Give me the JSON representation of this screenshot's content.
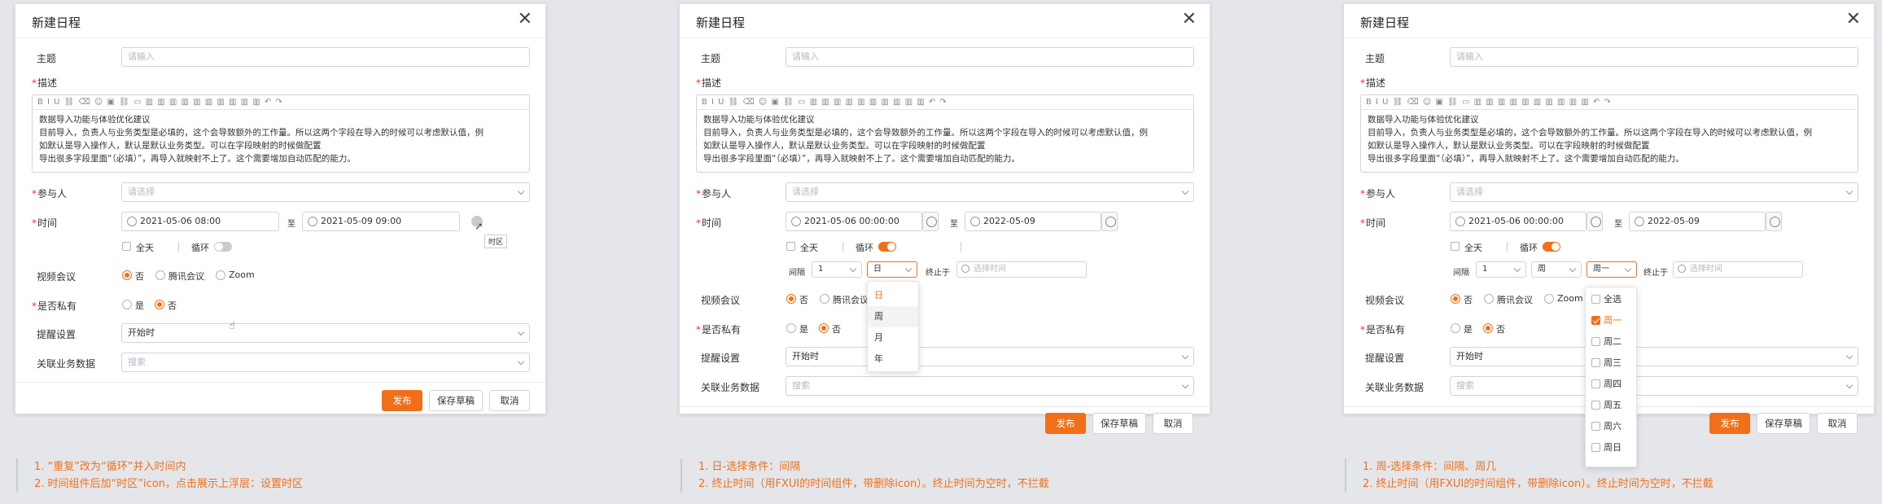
{
  "common": {
    "title": "新建日程",
    "subject_label": "主题",
    "subject_placeholder": "请输入",
    "desc_label": "描述",
    "toolbar_icons": "B  I  U  ⛓  ⌫  ☺  ▣  ⛓  ▭   ▥ ▥ ▥ ▥ ▥ ▥ ▥ ▥ ▥ ▥   ↶  ↷",
    "desc_lines": [
      "目前导入，负责人与业务类型是必填的，这个会导致额外的工作量。所以这两个字段在导入的时候可以考虑默认值，例",
      "如默认是导入操作人，默认是默认业务类型。可以在字段映射的时候做配置",
      "导出很多字段里面“（必填）”，再导入就映射不上了。这个需要增加自动匹配的能力。"
    ],
    "participant_label": "参与人",
    "participant_placeholder": "请选择",
    "time_label": "时间",
    "to": "至",
    "allday": "全天",
    "repeat": "循环",
    "video_label": "视频会议",
    "video_opts": [
      "否",
      "腾讯会议",
      "Zoom"
    ],
    "private_label": "是否私有",
    "private_opts": [
      "是",
      "否"
    ],
    "remind_label": "提醒设置",
    "remind_value": "开始时",
    "related_label": "关联业务数据",
    "related_placeholder": "搜索",
    "buttons": {
      "publish": "发布",
      "draft": "保存草稿",
      "cancel": "取消"
    },
    "interval_label": "间隔",
    "end_label": "终止于",
    "end_placeholder": "选择时间"
  },
  "panels": [
    {
      "desc_first": "数据导入功能与体验优化建议",
      "start": "2021-05-06 08:00",
      "end": "2021-05-09 09:00",
      "tooltip": "时区"
    },
    {
      "desc_first": "数据导入功能与体验优化建议",
      "start": "2021-05-06 00:00:00",
      "end": "2022-05-09",
      "interval": "1",
      "unit": "日",
      "unit_options": [
        "日",
        "周",
        "月",
        "年"
      ]
    },
    {
      "desc_first": "数据导入功能与体验优化建议",
      "start": "2021-05-06 00:00:00",
      "end": "2022-05-09",
      "interval": "1",
      "unit": "周",
      "weekday": "周一",
      "week_options": [
        "全选",
        "周一",
        "周二",
        "周三",
        "周四",
        "周五",
        "周六",
        "周日"
      ]
    }
  ],
  "notes": [
    [
      "1. “重复”改为“循环”并入时间内",
      "2. 时间组件后加“时区”icon，点击展示上浮层：设置时区"
    ],
    [
      "1. 日-选择条件：间隔",
      "2. 终止时间（用FXUI的时间组件，带删除icon）。终止时间为空时，不拦截"
    ],
    [
      "1. 周-选择条件：间隔、周几",
      "2. 终止时间（用FXUI的时间组件，带删除icon）。终止时间为空时，不拦截"
    ]
  ],
  "colors": {
    "accent": "#f0701a",
    "required": "#e53935"
  }
}
